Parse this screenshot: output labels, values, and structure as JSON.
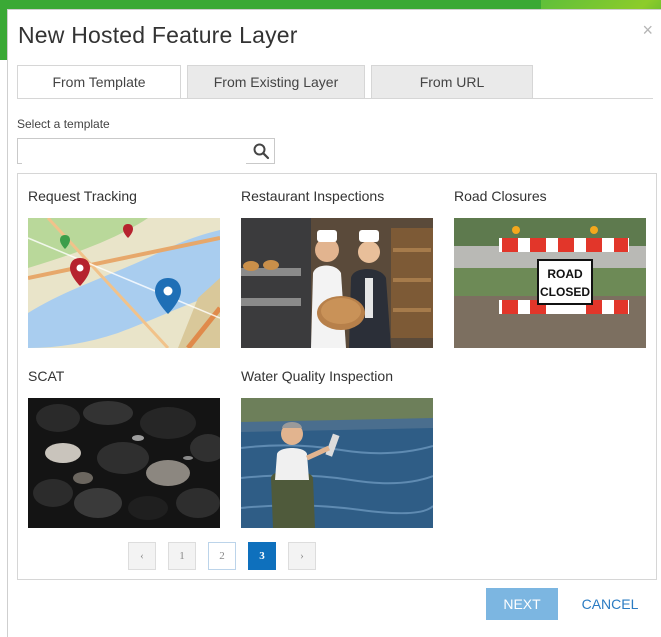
{
  "dialog": {
    "title": "New Hosted Feature Layer",
    "close_glyph": "×"
  },
  "tabs": [
    {
      "label": "From Template",
      "active": true
    },
    {
      "label": "From Existing Layer",
      "active": false
    },
    {
      "label": "From URL",
      "active": false
    }
  ],
  "search": {
    "label": "Select a template",
    "value": "",
    "placeholder": "",
    "icon": "search-icon"
  },
  "templates": [
    {
      "name": "Request Tracking"
    },
    {
      "name": "Restaurant Inspections"
    },
    {
      "name": "Road Closures"
    },
    {
      "name": "SCAT"
    },
    {
      "name": "Water Quality Inspection"
    }
  ],
  "road_sign": {
    "line1": "ROAD",
    "line2": "CLOSED"
  },
  "pagination": {
    "prev": "‹",
    "pages": [
      "1",
      "2",
      "3"
    ],
    "current": "3",
    "next": "›"
  },
  "footer": {
    "next_label": "NEXT",
    "cancel_label": "CANCEL"
  },
  "colors": {
    "accent": "#0e70bd",
    "next_button": "#7cb6e1",
    "background_green": "#3aa935"
  }
}
